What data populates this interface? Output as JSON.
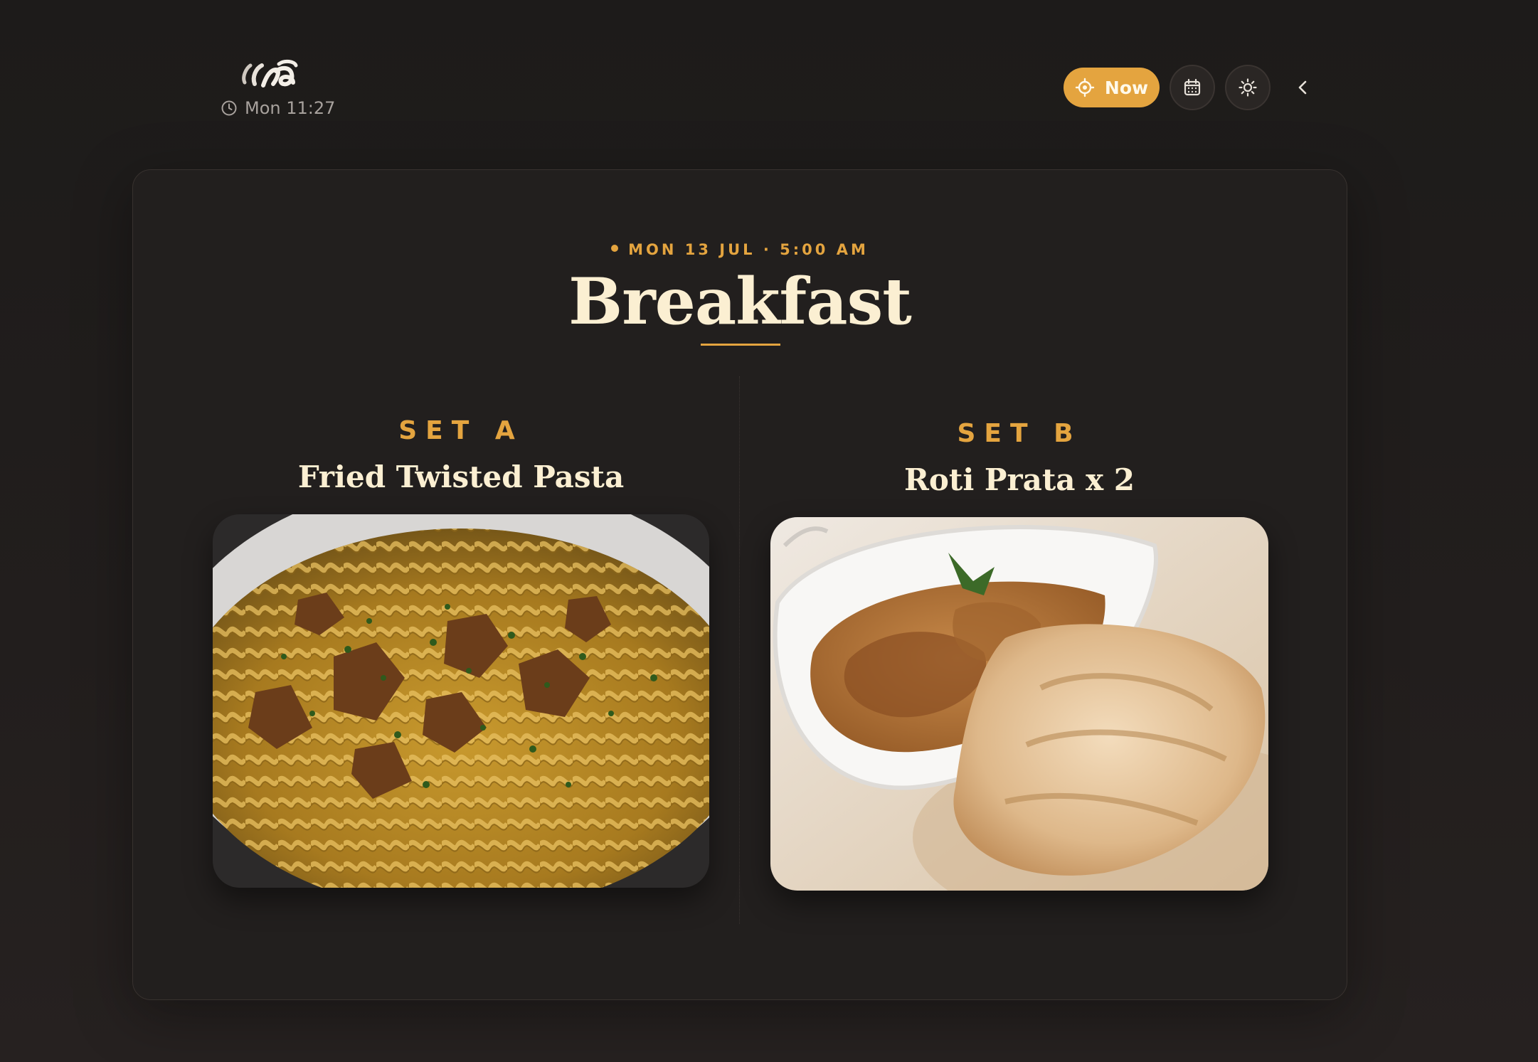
{
  "header": {
    "logo_icon": "brand-logo",
    "clock_icon": "clock-icon",
    "time": "Mon 11:27"
  },
  "controls": {
    "now_label": "Now",
    "now_icon": "locate-icon",
    "calendar_icon": "calendar-icon",
    "theme_icon": "sun-icon",
    "collapse_icon": "chevron-left-icon"
  },
  "meal": {
    "meta": "MON 13 JUL · 5:00 AM",
    "title": "Breakfast",
    "sets": [
      {
        "label": "SET A",
        "dish": "Fried Twisted Pasta",
        "image": "pasta-photo"
      },
      {
        "label": "SET B",
        "dish": "Roti Prata x 2",
        "image": "roti-prata-photo"
      }
    ]
  },
  "colors": {
    "accent": "#e4a43f",
    "title": "#fbefd2",
    "background": "#1f1c1b",
    "card": "#221f1e"
  }
}
